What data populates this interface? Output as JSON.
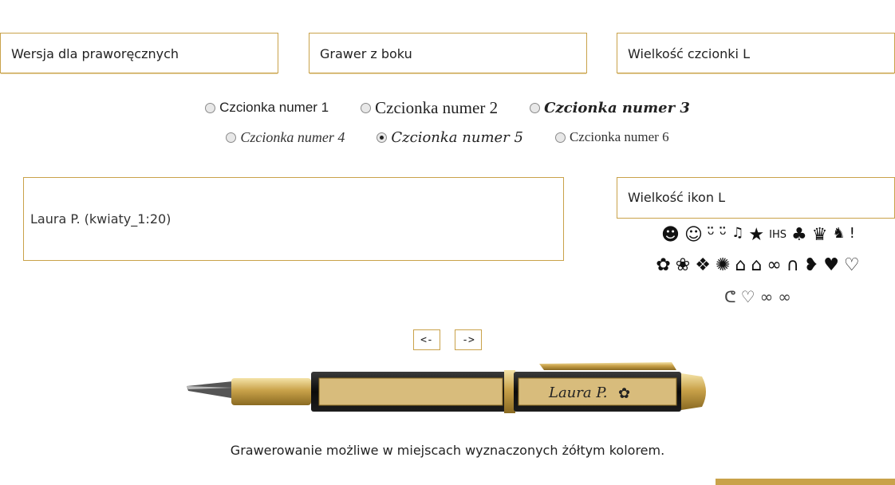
{
  "selects": {
    "version": "Wersja dla praworęcznych",
    "engraving": "Grawer z boku",
    "font_size": "Wielkość czcionki L"
  },
  "fonts": [
    {
      "label": "Czcionka numer 1",
      "selected": false
    },
    {
      "label": "Czcionka numer 2",
      "selected": false
    },
    {
      "label": "Czcionka numer 3",
      "selected": false
    },
    {
      "label": "Czcionka numer 4",
      "selected": false
    },
    {
      "label": "Czcionka numer 5",
      "selected": true
    },
    {
      "label": "Czcionka numer 6",
      "selected": false
    }
  ],
  "engraving_text": "Laura P. (kwiaty_1:20)",
  "icon_size": "Wielkość ikon L",
  "icons": {
    "row1": [
      "smiley-face",
      "smiley-face-outline",
      "grin",
      "grin-wide",
      "music-notes",
      "star",
      "ihs-monogram",
      "four-leaf-clover",
      "crown",
      "cat",
      "pointer"
    ],
    "row2": [
      "rose",
      "rose-bud",
      "paw",
      "sun-badge",
      "graduation-cap",
      "graduation-cap-2",
      "wedding-rings",
      "horseshoe",
      "heart-half",
      "heart",
      "heart-outline"
    ],
    "row3": [
      "heart-swirl",
      "double-heart",
      "infinity",
      "infinity-2"
    ]
  },
  "nav": {
    "prev": "<-",
    "next": "->"
  },
  "preview_text": "Laura P.",
  "note": "Grawerowanie możliwe w miejscach wyznaczonych żółtym kolorem.",
  "colors": {
    "accent": "#c9a24a",
    "pen_body": "#111111",
    "engrave_area": "#d8bc7c"
  }
}
